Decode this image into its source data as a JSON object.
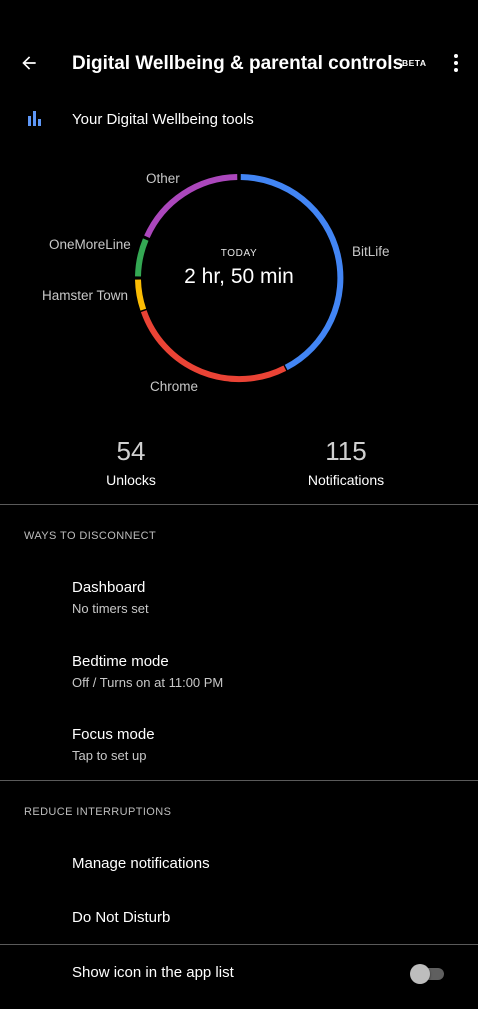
{
  "header": {
    "title": "Digital Wellbeing & parental controls",
    "badge": "BETA",
    "back_icon": "arrow-left-icon",
    "menu_icon": "more-vert-icon"
  },
  "tools": {
    "label": "Your Digital Wellbeing tools",
    "icon": "bar-chart-icon",
    "icon_color": "#5e97f6"
  },
  "usage": {
    "period": "TODAY",
    "total": "2 hr, 50 min",
    "apps": [
      {
        "name": "BitLife",
        "color": "#4285f4"
      },
      {
        "name": "Chrome",
        "color": "#ea4335"
      },
      {
        "name": "Hamster Town",
        "color": "#fbbc04"
      },
      {
        "name": "OneMoreLine",
        "color": "#34a853"
      },
      {
        "name": "Other",
        "color": "#ab47bc"
      }
    ]
  },
  "stats": {
    "unlocks": {
      "value": "54",
      "label": "Unlocks"
    },
    "notifications": {
      "value": "115",
      "label": "Notifications"
    }
  },
  "ways_to_disconnect": {
    "heading": "WAYS TO DISCONNECT",
    "items": [
      {
        "title": "Dashboard",
        "subtitle": "No timers set"
      },
      {
        "title": "Bedtime mode",
        "subtitle": "Off / Turns on at 11:00 PM"
      },
      {
        "title": "Focus mode",
        "subtitle": "Tap to set up"
      }
    ]
  },
  "reduce_interruptions": {
    "heading": "REDUCE INTERRUPTIONS",
    "items": [
      {
        "title": "Manage notifications"
      },
      {
        "title": "Do Not Disturb"
      }
    ]
  },
  "show_icon": {
    "label": "Show icon in the app list",
    "enabled": false
  }
}
